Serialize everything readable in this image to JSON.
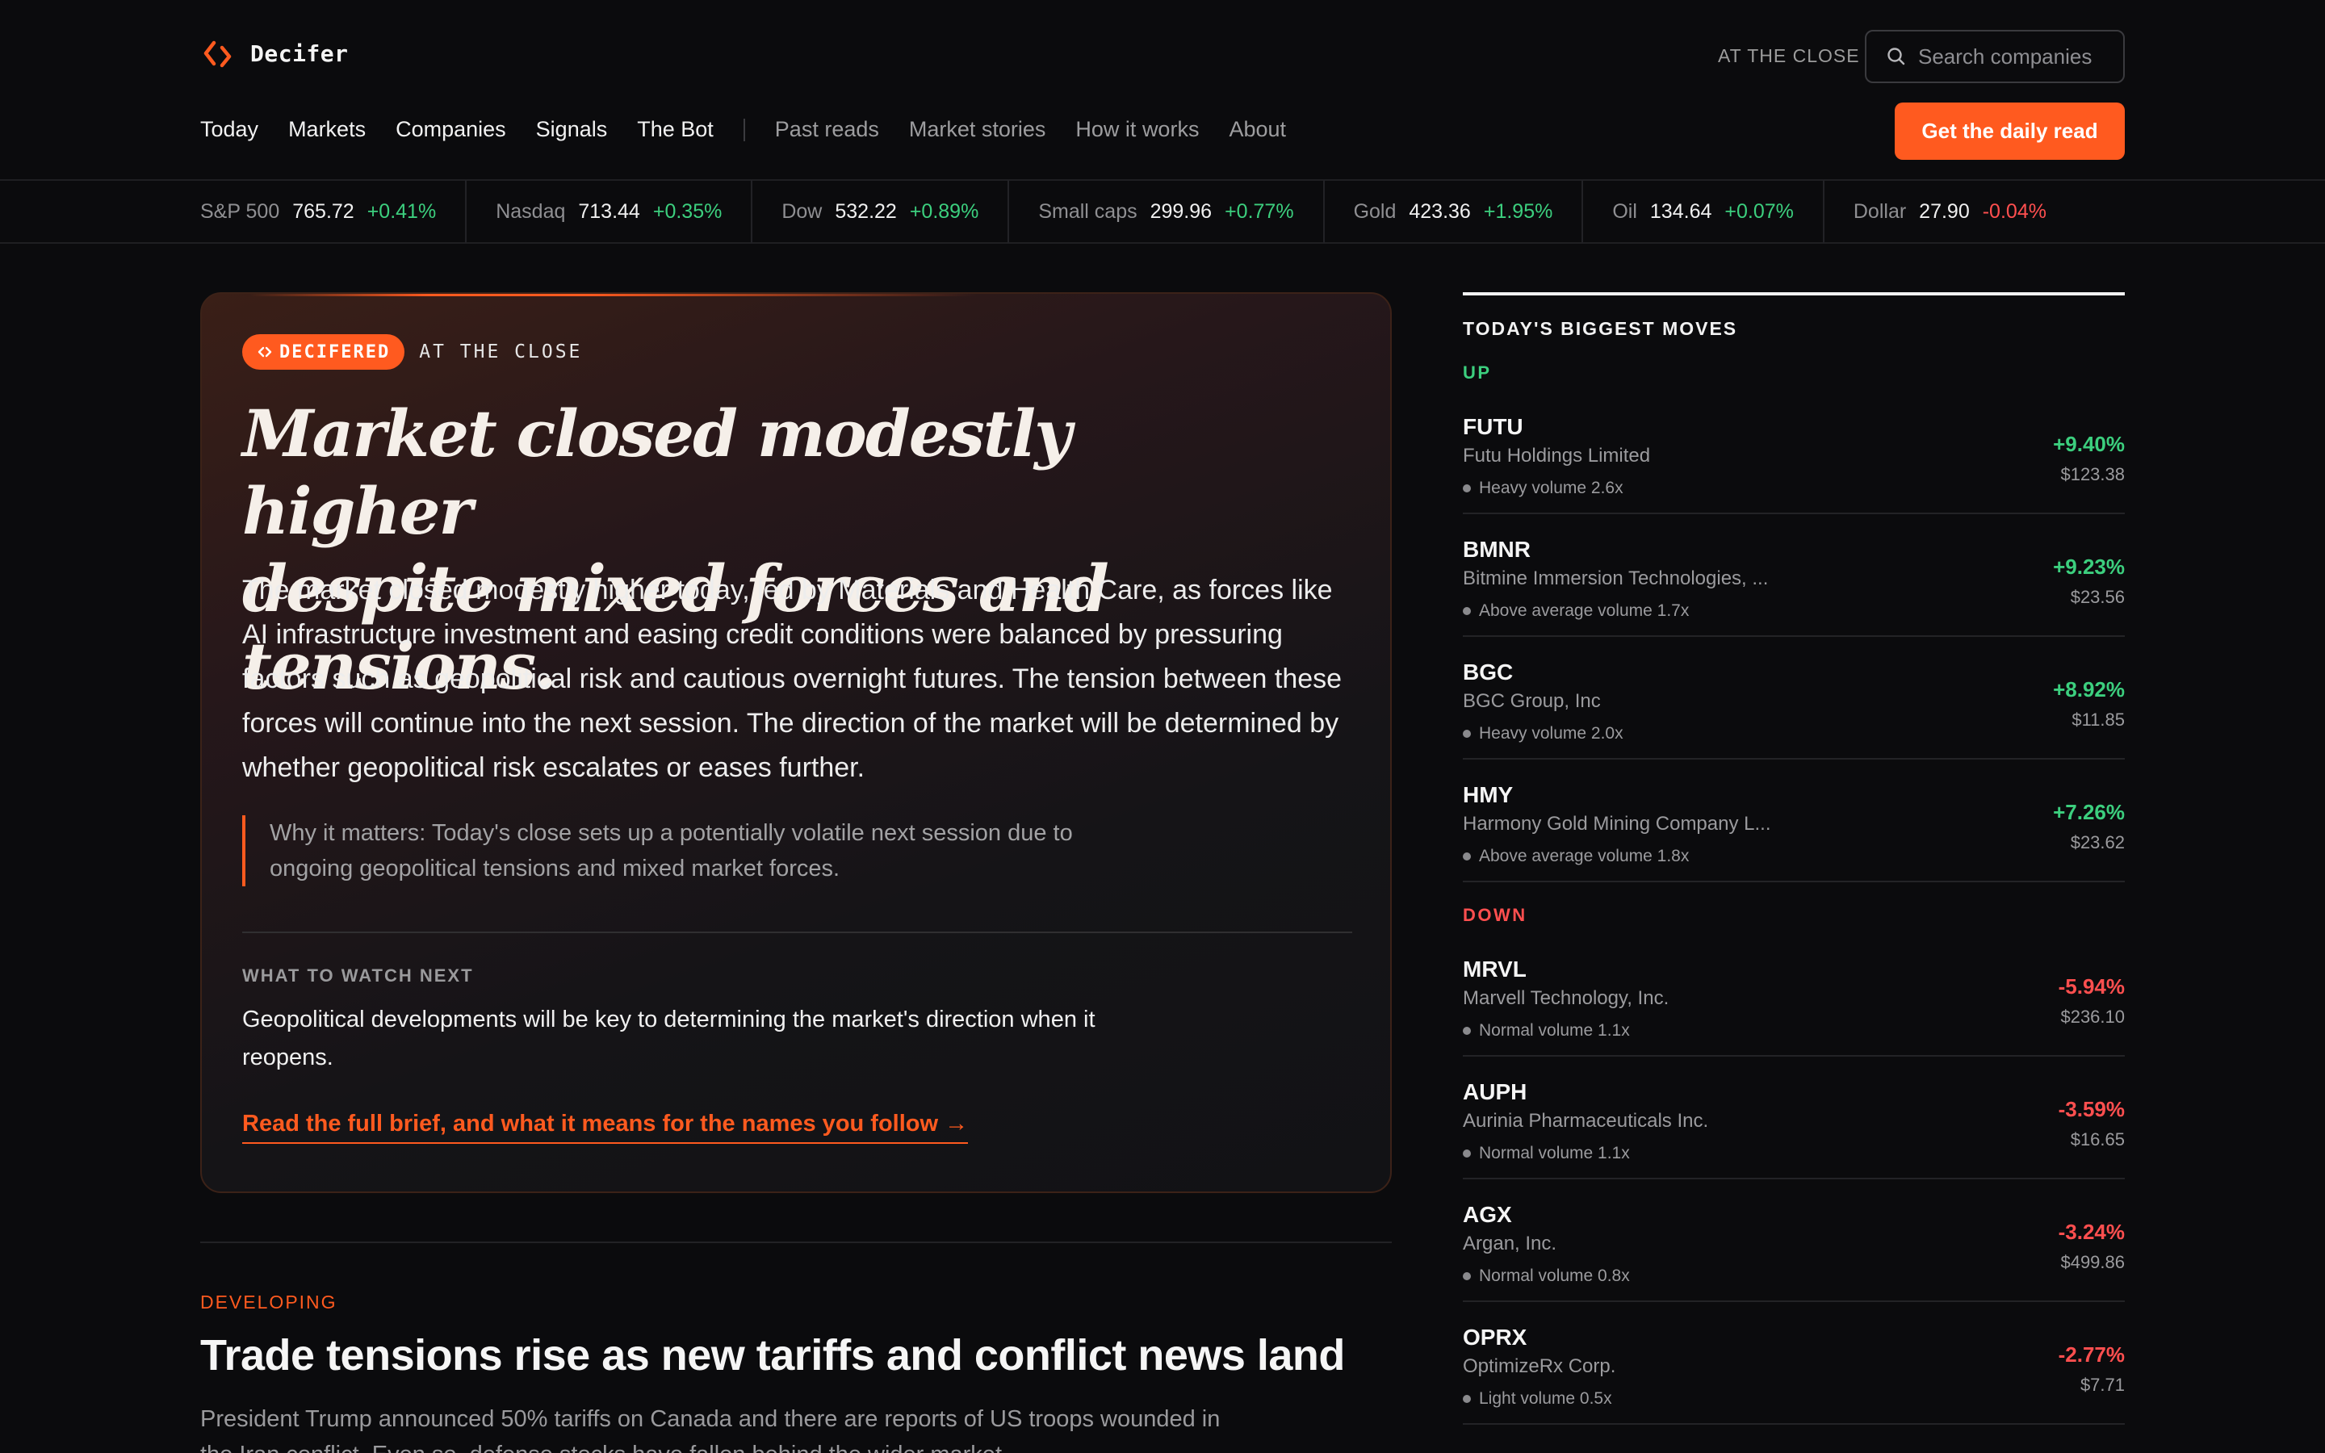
{
  "brand": {
    "name": "Decifer"
  },
  "header": {
    "at_close_label": "AT THE CLOSE",
    "search_placeholder": "Search companies",
    "cta_label": "Get the daily read"
  },
  "nav": {
    "primary": [
      "Today",
      "Markets",
      "Companies",
      "Signals",
      "The Bot"
    ],
    "secondary": [
      "Past reads",
      "Market stories",
      "How it works",
      "About"
    ]
  },
  "ticker": [
    {
      "name": "S&P 500",
      "value": "765.72",
      "change": "+0.41%",
      "direction": "up"
    },
    {
      "name": "Nasdaq",
      "value": "713.44",
      "change": "+0.35%",
      "direction": "up"
    },
    {
      "name": "Dow",
      "value": "532.22",
      "change": "+0.89%",
      "direction": "up"
    },
    {
      "name": "Small caps",
      "value": "299.96",
      "change": "+0.77%",
      "direction": "up"
    },
    {
      "name": "Gold",
      "value": "423.36",
      "change": "+1.95%",
      "direction": "up"
    },
    {
      "name": "Oil",
      "value": "134.64",
      "change": "+0.07%",
      "direction": "up"
    },
    {
      "name": "Dollar",
      "value": "27.90",
      "change": "-0.04%",
      "direction": "down"
    }
  ],
  "hero": {
    "badge": "DECIFERED",
    "badge_suffix": "AT THE CLOSE",
    "headline_line1": "Market closed modestly higher",
    "headline_line2": "despite mixed forces and tensions.",
    "body": "The market closed modestly higher today, led by Materials and Health Care, as forces like AI infrastructure investment and easing credit conditions were balanced by pressuring factors such as geopolitical risk and cautious overnight futures. The tension between these forces will continue into the next session. The direction of the market will be determined by whether geopolitical risk escalates or eases further.",
    "why_it_matters": "Why it matters: Today's close sets up a potentially volatile next session due to ongoing geopolitical tensions and mixed market forces.",
    "watch_label": "WHAT TO WATCH NEXT",
    "watch_text": "Geopolitical developments will be key to determining the market's direction when it reopens.",
    "read_more": "Read the full brief, and what it means for the names you follow →"
  },
  "developing": {
    "label": "DEVELOPING",
    "title": "Trade tensions rise as new tariffs and conflict news land",
    "text": "President Trump announced 50% tariffs on Canada and there are reports of US troops wounded in the Iran conflict. Even so, defense stocks have fallen behind the wider market."
  },
  "moves": {
    "title": "TODAY'S BIGGEST MOVES",
    "up_label": "UP",
    "down_label": "DOWN",
    "up": [
      {
        "symbol": "FUTU",
        "company": "Futu Holdings Limited",
        "volume": "Heavy volume 2.6x",
        "change": "+9.40%",
        "price": "$123.38"
      },
      {
        "symbol": "BMNR",
        "company": "Bitmine Immersion Technologies, ...",
        "volume": "Above average volume 1.7x",
        "change": "+9.23%",
        "price": "$23.56"
      },
      {
        "symbol": "BGC",
        "company": "BGC Group, Inc",
        "volume": "Heavy volume 2.0x",
        "change": "+8.92%",
        "price": "$11.85"
      },
      {
        "symbol": "HMY",
        "company": "Harmony Gold Mining Company L...",
        "volume": "Above average volume 1.8x",
        "change": "+7.26%",
        "price": "$23.62"
      }
    ],
    "down": [
      {
        "symbol": "MRVL",
        "company": "Marvell Technology, Inc.",
        "volume": "Normal volume 1.1x",
        "change": "-5.94%",
        "price": "$236.10"
      },
      {
        "symbol": "AUPH",
        "company": "Aurinia Pharmaceuticals Inc.",
        "volume": "Normal volume 1.1x",
        "change": "-3.59%",
        "price": "$16.65"
      },
      {
        "symbol": "AGX",
        "company": "Argan, Inc.",
        "volume": "Normal volume 0.8x",
        "change": "-3.24%",
        "price": "$499.86"
      },
      {
        "symbol": "OPRX",
        "company": "OptimizeRx Corp.",
        "volume": "Light volume 0.5x",
        "change": "-2.77%",
        "price": "$7.71"
      }
    ]
  },
  "colors": {
    "accent": "#ff5a1f",
    "up": "#3ccf7e",
    "down": "#ff4f4f",
    "background": "#0b0b0d"
  }
}
